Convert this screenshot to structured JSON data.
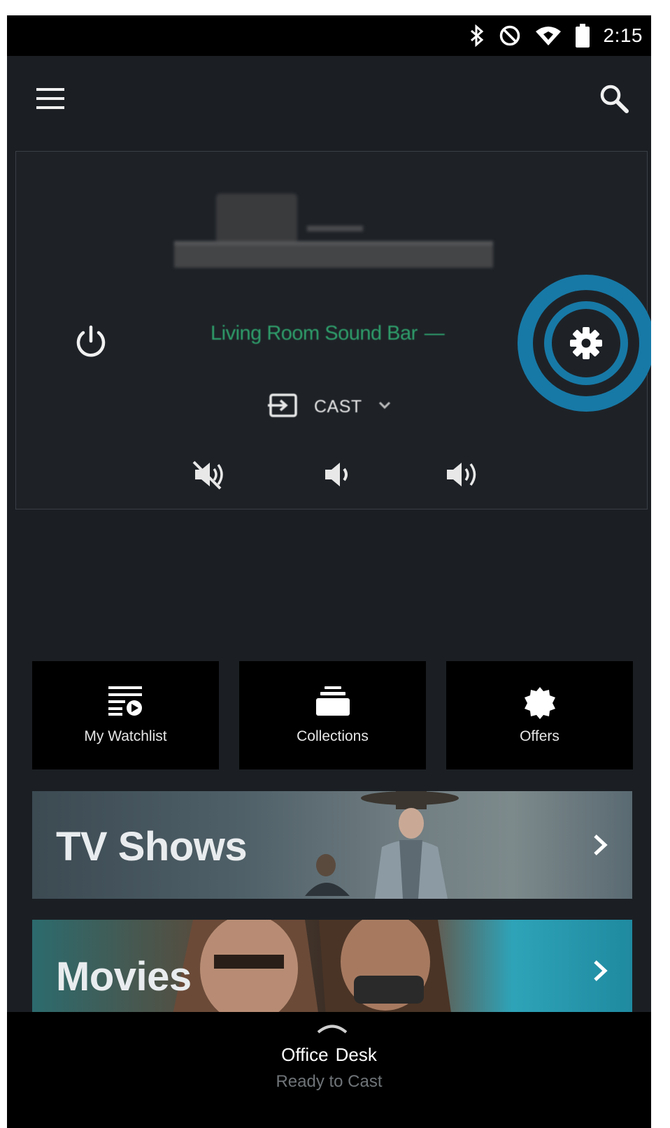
{
  "status_bar": {
    "time": "2:15",
    "icons": [
      "bluetooth-icon",
      "do-not-disturb-icon",
      "wifi-icon",
      "battery-icon"
    ]
  },
  "app_bar": {
    "menu_icon": "menu-icon",
    "search_icon": "search-icon"
  },
  "device": {
    "name": "Living Room Sound Bar",
    "name_suffix": "—",
    "name_color": "#2fa06c",
    "input_icon": "input-source-icon",
    "input_label": "CAST",
    "power_icon": "power-icon",
    "settings_icon": "gear-icon",
    "volume_controls": [
      "mute-icon",
      "volume-down-icon",
      "volume-up-icon"
    ]
  },
  "highlight_color": "#1779a6",
  "tiles": [
    {
      "label": "My Watchlist",
      "icon": "watchlist-icon"
    },
    {
      "label": "Collections",
      "icon": "collections-icon"
    },
    {
      "label": "Offers",
      "icon": "offers-badge-icon"
    }
  ],
  "banners": [
    {
      "title": "TV Shows"
    },
    {
      "title": "Movies"
    }
  ],
  "cast_bar": {
    "device_first": "Office",
    "device_second": "Desk",
    "status": "Ready to Cast"
  }
}
